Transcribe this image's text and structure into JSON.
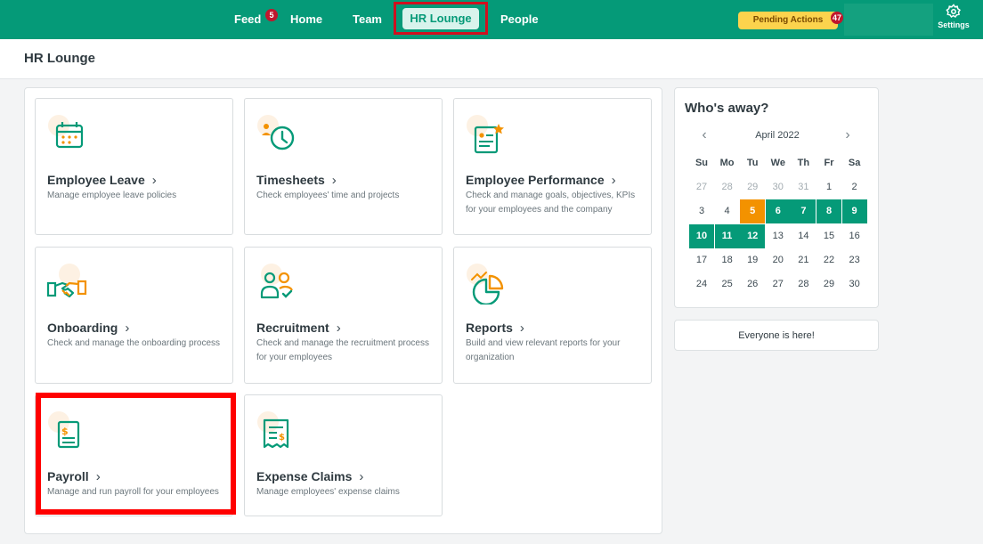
{
  "nav": {
    "feed": "Feed",
    "feed_badge": "5",
    "home": "Home",
    "team": "Team",
    "hr_lounge": "HR Lounge",
    "people": "People",
    "pending_actions": "Pending Actions",
    "pending_badge": "47",
    "settings": "Settings"
  },
  "page": {
    "title": "HR Lounge"
  },
  "cards": [
    {
      "title": "Employee Leave",
      "desc": "Manage employee leave policies"
    },
    {
      "title": "Timesheets",
      "desc": "Check employees' time and projects"
    },
    {
      "title": "Employee Performance",
      "desc": "Check and manage goals, objectives, KPIs for your employees and the company"
    },
    {
      "title": "Onboarding",
      "desc": "Check and manage the onboarding process"
    },
    {
      "title": "Recruitment",
      "desc": "Check and manage the recruitment process for your employees"
    },
    {
      "title": "Reports",
      "desc": "Build and view relevant reports for your organization"
    },
    {
      "title": "Payroll",
      "desc": "Manage and run payroll for your employees"
    },
    {
      "title": "Expense Claims",
      "desc": "Manage employees' expense claims"
    }
  ],
  "away": {
    "title": "Who's away?",
    "month": "April 2022",
    "weekdays": [
      "Su",
      "Mo",
      "Tu",
      "We",
      "Th",
      "Fr",
      "Sa"
    ],
    "weeks": [
      [
        "27",
        "28",
        "29",
        "30",
        "31",
        "1",
        "2"
      ],
      [
        "3",
        "4",
        "5",
        "6",
        "7",
        "8",
        "9"
      ],
      [
        "10",
        "11",
        "12",
        "13",
        "14",
        "15",
        "16"
      ],
      [
        "17",
        "18",
        "19",
        "20",
        "21",
        "22",
        "23"
      ],
      [
        "24",
        "25",
        "26",
        "27",
        "28",
        "29",
        "30"
      ]
    ],
    "today": "5",
    "away_days": [
      "6",
      "7",
      "8",
      "9",
      "10",
      "11",
      "12"
    ],
    "everyone_here": "Everyone is here!"
  },
  "colors": {
    "brand": "#059a78",
    "accent_orange": "#f39200",
    "pending_yellow": "#fcd34d",
    "badge_red": "#c0172d"
  },
  "icons": {
    "employee_leave": "calendar-icon",
    "timesheets": "clock-person-icon",
    "employee_performance": "document-star-icon",
    "onboarding": "handshake-icon",
    "recruitment": "people-check-icon",
    "reports": "pie-chart-icon",
    "payroll": "dollar-document-icon",
    "expense_claims": "receipt-icon",
    "settings": "gear-icon"
  }
}
